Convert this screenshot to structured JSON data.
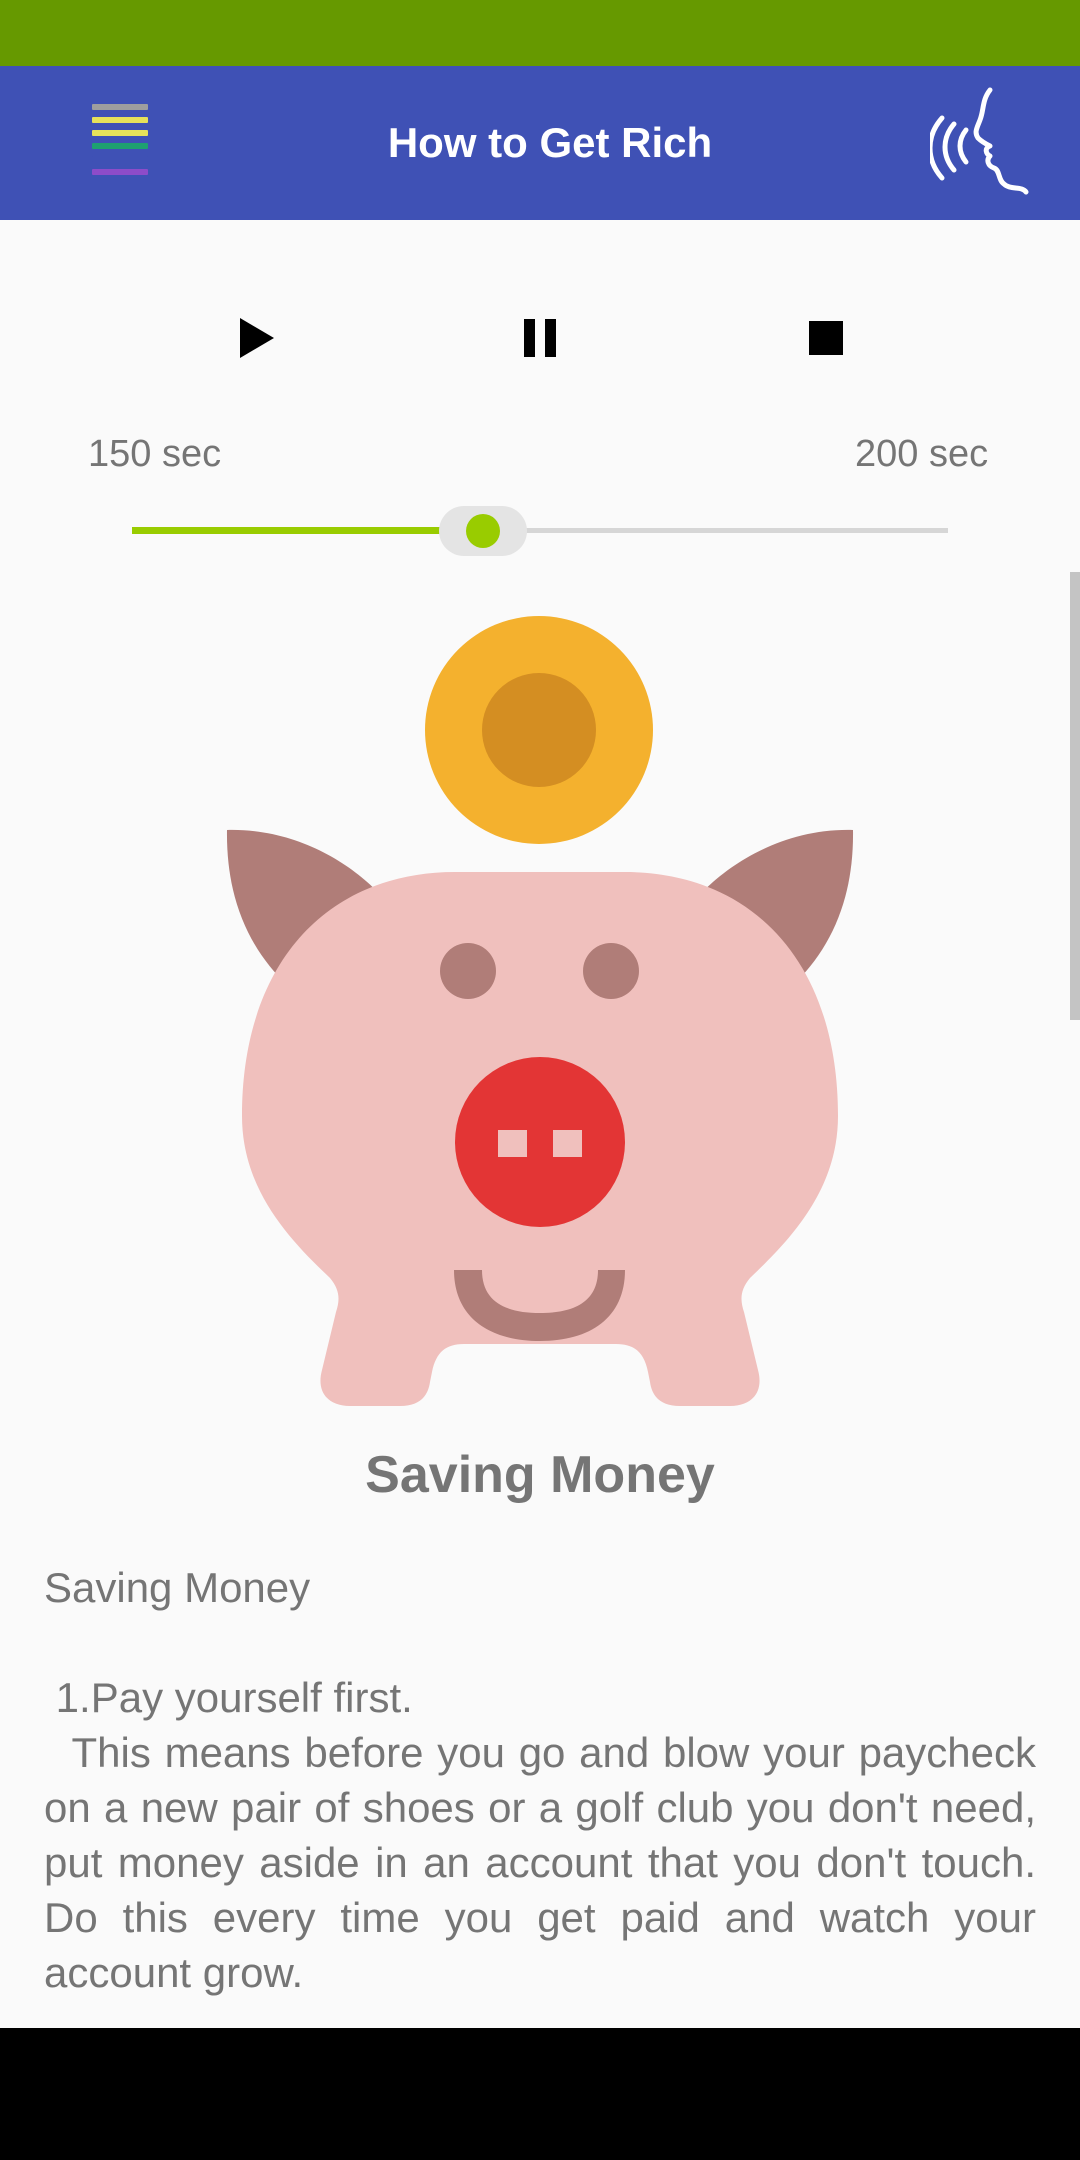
{
  "app_bar": {
    "title": "How to Get Rich",
    "menu_icon": "menu-icon",
    "speak_icon": "speaking-head-icon"
  },
  "player": {
    "play_icon": "play-icon",
    "pause_icon": "pause-icon",
    "stop_icon": "stop-icon",
    "min_label": "150 sec",
    "max_label": "200 sec",
    "slider_fraction": 0.43
  },
  "article": {
    "image": "piggy-bank-coin-illustration",
    "heading": "Saving Money",
    "subheading": "Saving Money",
    "point_title": " 1.Pay yourself first.",
    "point_body": "  This means before you go and blow your paycheck on a new pair of shoes or a golf club you don't need, put money aside in an account that you don't touch. Do this every time you get paid and watch your account grow."
  },
  "colors": {
    "status_bar": "#669900",
    "app_bar": "#3f51b5",
    "slider_accent": "#99cc00",
    "coin": "#f4b12e",
    "pig_body": "#f0c0bd",
    "pig_ears": "#b07d78",
    "pig_snout": "#e33535"
  }
}
